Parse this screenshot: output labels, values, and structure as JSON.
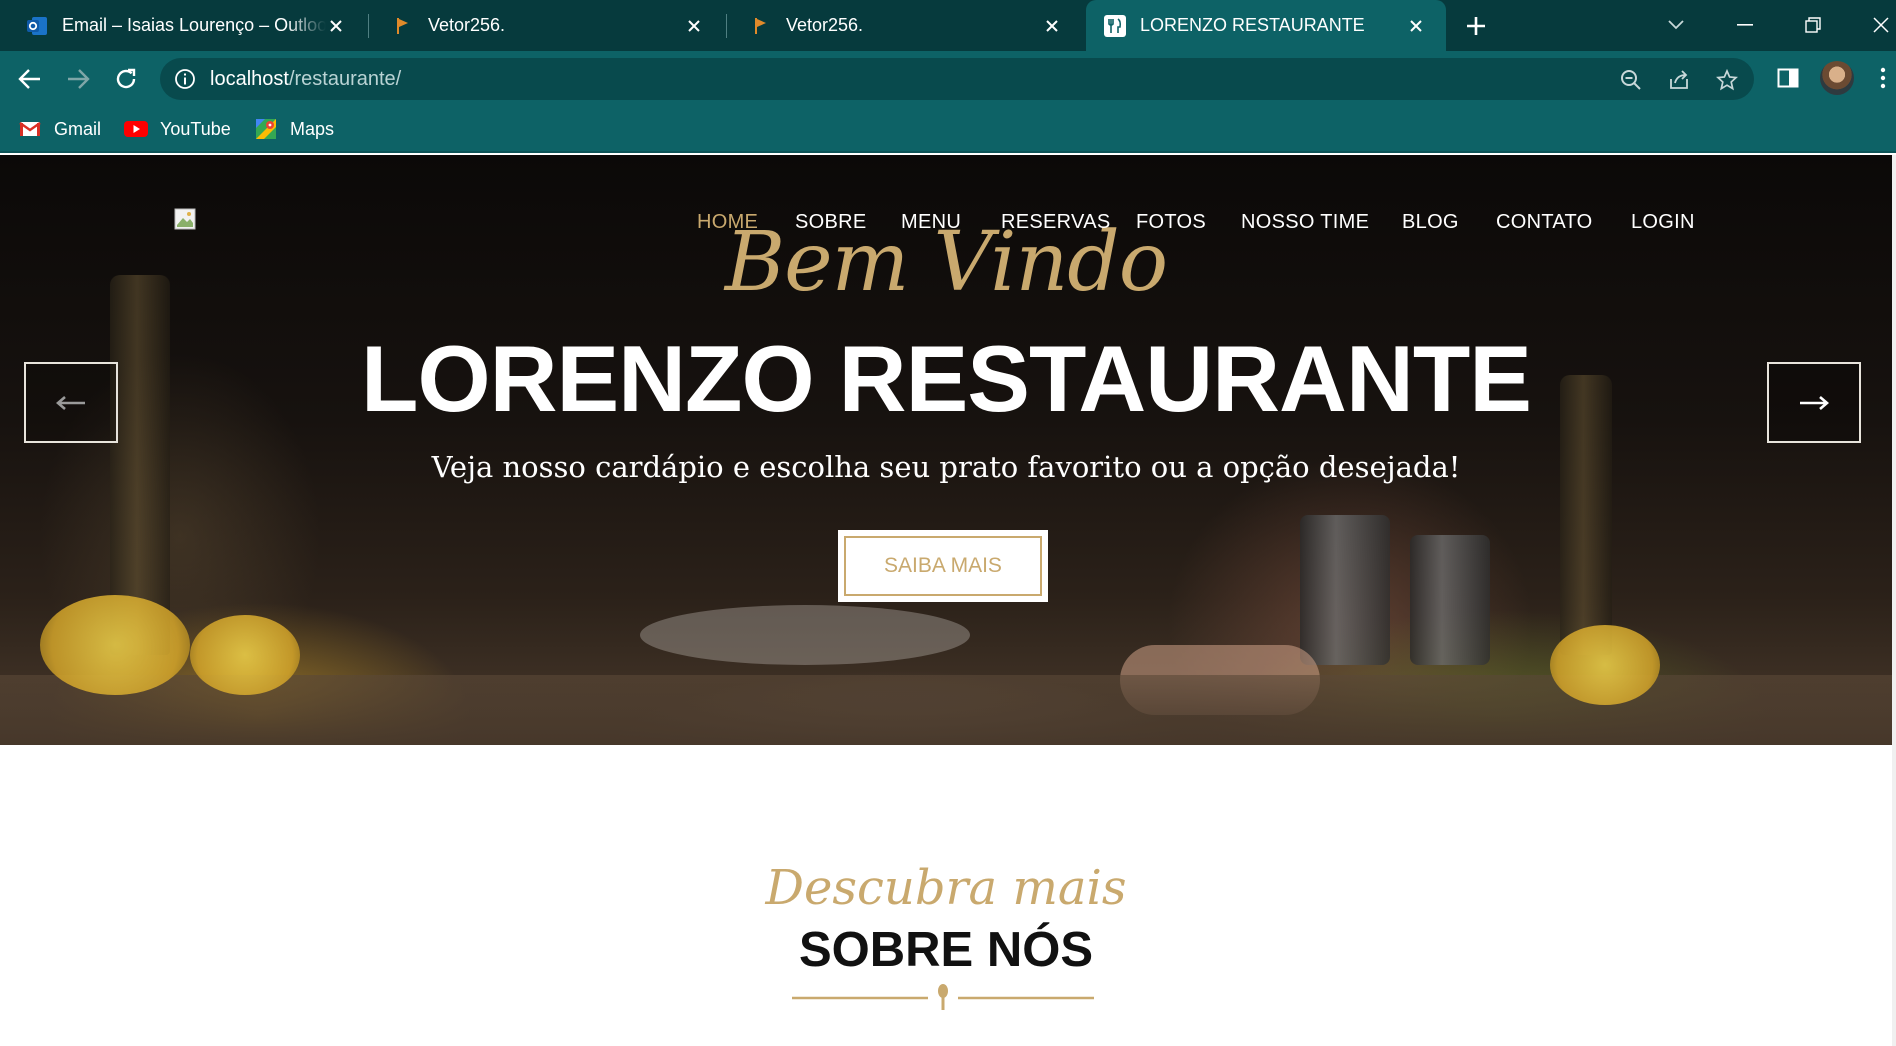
{
  "browser": {
    "tabs": [
      {
        "title": "Email – Isaias Lourenço – Outlook",
        "icon": "outlook-icon"
      },
      {
        "title": "Vetor256.",
        "icon": "vetor-flag-icon"
      },
      {
        "title": "Vetor256.",
        "icon": "vetor-flag-icon"
      },
      {
        "title": "LORENZO RESTAURANTE",
        "icon": "restaurant-fork-knife-icon",
        "active": true
      }
    ],
    "url_host": "localhost",
    "url_path": "/restaurante/",
    "bookmarks": [
      {
        "label": "Gmail",
        "icon": "gmail-icon"
      },
      {
        "label": "YouTube",
        "icon": "youtube-icon"
      },
      {
        "label": "Maps",
        "icon": "maps-icon"
      }
    ],
    "colors": {
      "tabstrip": "#063a3d",
      "toolbar": "#0d6266",
      "omnibox": "#084a4d"
    }
  },
  "site": {
    "nav": [
      {
        "label": "HOME",
        "active": true
      },
      {
        "label": "SOBRE"
      },
      {
        "label": "MENU"
      },
      {
        "label": "RESERVAS"
      },
      {
        "label": "FOTOS"
      },
      {
        "label": "NOSSO TIME"
      },
      {
        "label": "BLOG"
      },
      {
        "label": "CONTATO"
      },
      {
        "label": "LOGIN"
      }
    ],
    "hero": {
      "script": "Bem Vindo",
      "title": "LORENZO RESTAURANTE",
      "subtitle": "Veja nosso cardápio e escolha seu prato favorito ou a opção desejada!",
      "cta": "SAIBA MAIS"
    },
    "about": {
      "script": "Descubra mais",
      "title": "SOBRE NÓS"
    },
    "colors": {
      "accent": "#c9a96e",
      "heading": "#111111"
    }
  }
}
